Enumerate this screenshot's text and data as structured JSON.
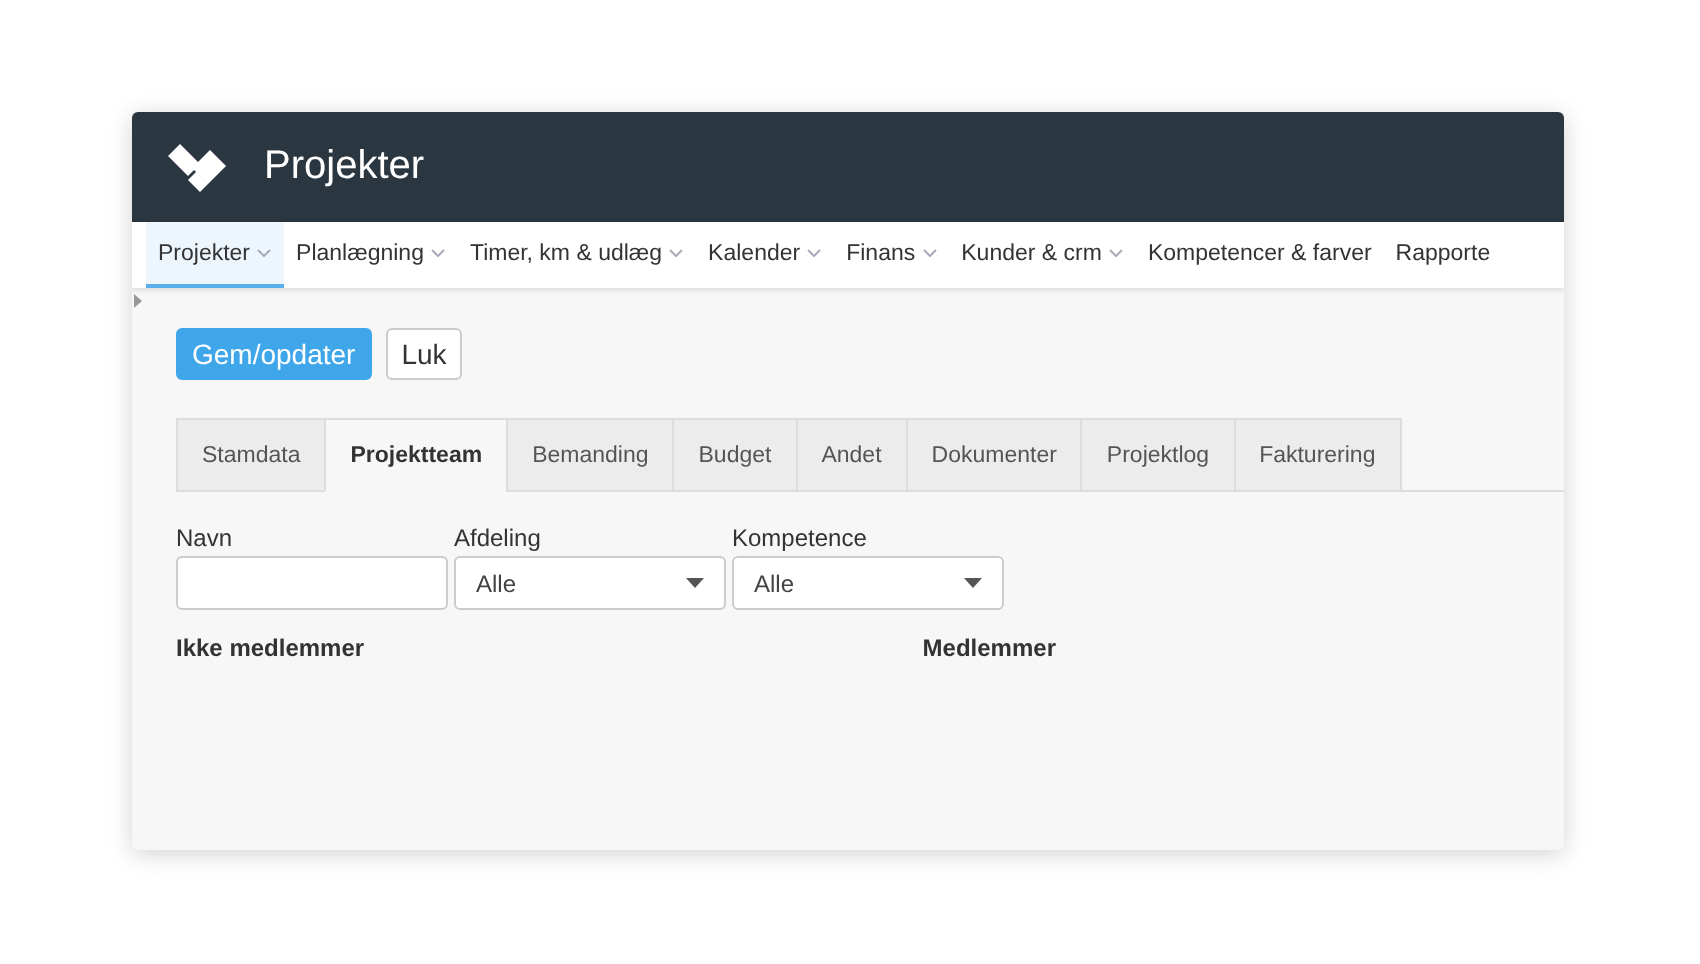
{
  "header": {
    "title": "Projekter"
  },
  "nav": [
    {
      "label": "Projekter",
      "has_menu": true,
      "selected": true
    },
    {
      "label": "Planlægning",
      "has_menu": true,
      "selected": false
    },
    {
      "label": "Timer, km & udlæg",
      "has_menu": true,
      "selected": false
    },
    {
      "label": "Kalender",
      "has_menu": true,
      "selected": false
    },
    {
      "label": "Finans",
      "has_menu": true,
      "selected": false
    },
    {
      "label": "Kunder & crm",
      "has_menu": true,
      "selected": false
    },
    {
      "label": "Kompetencer & farver",
      "has_menu": false,
      "selected": false
    },
    {
      "label": "Rapporte",
      "has_menu": false,
      "selected": false
    }
  ],
  "actions": [
    {
      "label": "Gem/opdater",
      "kind": "primary"
    },
    {
      "label": "Luk",
      "kind": "default"
    }
  ],
  "tabs": [
    {
      "label": "Stamdata",
      "selected": false
    },
    {
      "label": "Projektteam",
      "selected": true
    },
    {
      "label": "Bemanding",
      "selected": false
    },
    {
      "label": "Budget",
      "selected": false
    },
    {
      "label": "Andet",
      "selected": false
    },
    {
      "label": "Dokumenter",
      "selected": false
    },
    {
      "label": "Projektlog",
      "selected": false
    },
    {
      "label": "Fakturering",
      "selected": false
    }
  ],
  "filters": [
    {
      "label": "Navn",
      "kind": "text"
    },
    {
      "label": "Afdeling",
      "kind": "select",
      "value": "Alle"
    },
    {
      "label": "Kompetence",
      "kind": "select",
      "value": "Alle"
    }
  ],
  "lists": {
    "non_members": "Ikke medlemmer",
    "members": "Medlemmer"
  }
}
